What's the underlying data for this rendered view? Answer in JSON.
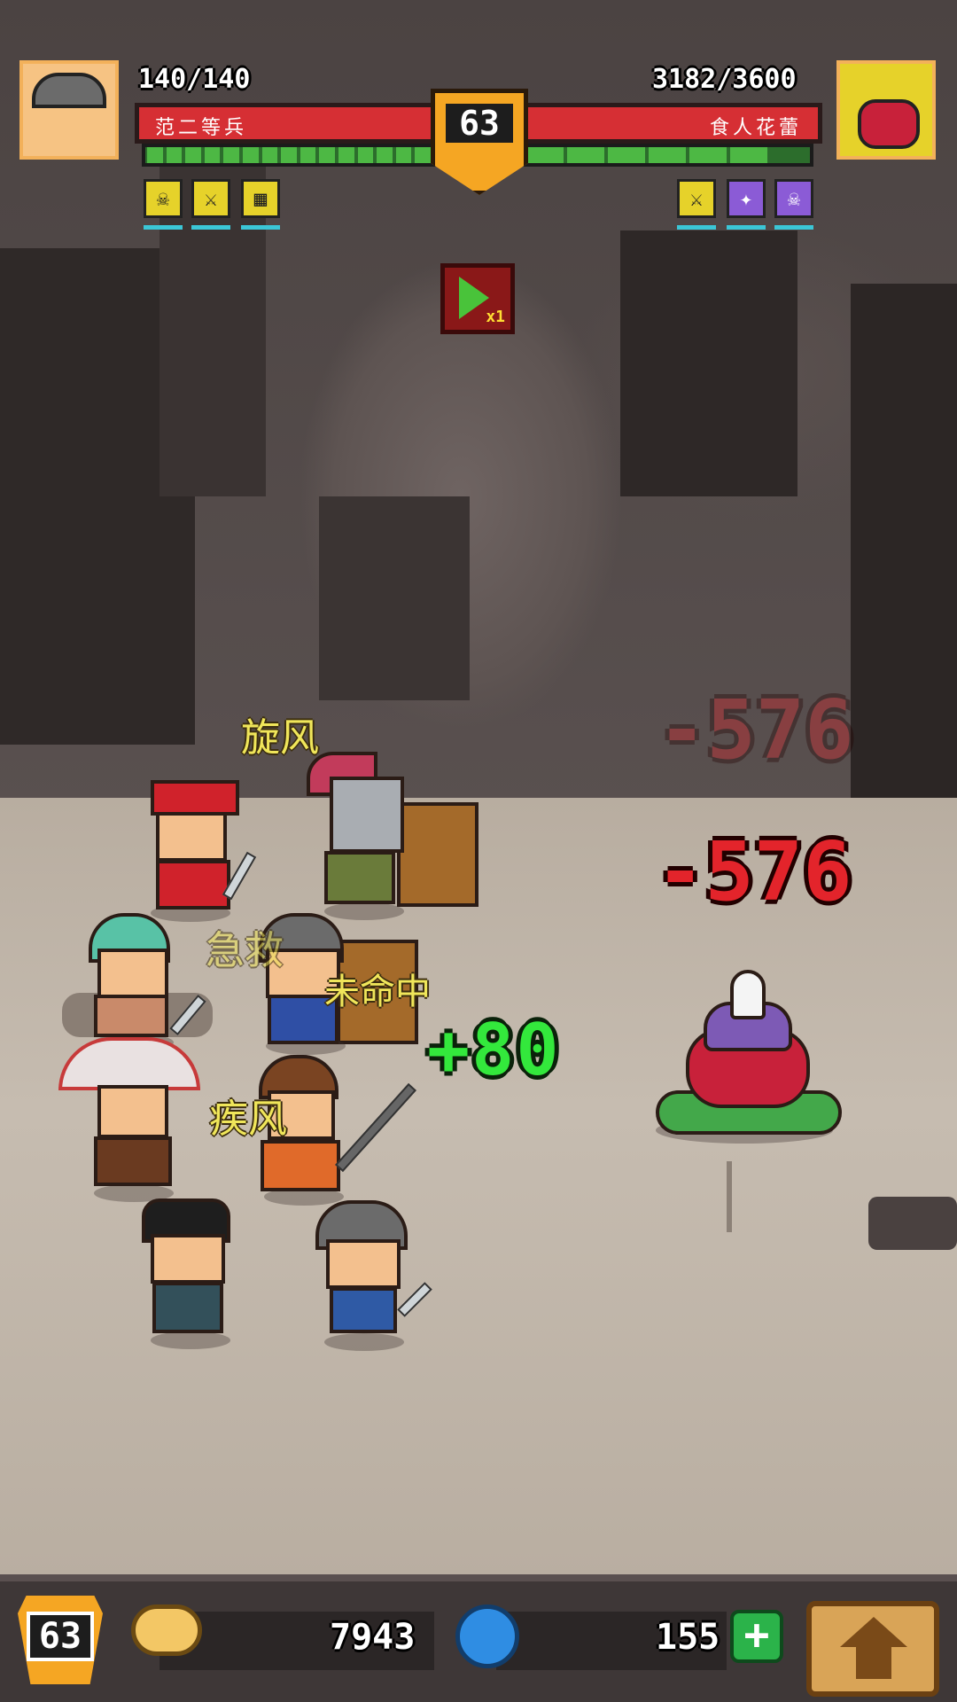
{
  "hud": {
    "player": {
      "hp": "140/140",
      "name": "范二等兵"
    },
    "enemy": {
      "hp": "3182/3600",
      "name": "食人花蕾"
    },
    "stage_level": "63",
    "speed_label": "x1"
  },
  "battle": {
    "floaters": [
      "旋风",
      "急救",
      "未命中",
      "疾风"
    ],
    "heal": "+80",
    "damage": "-576",
    "damage_ghost": "-576"
  },
  "bottom": {
    "player_level": "63",
    "gold": "7943",
    "gems": "155",
    "add_label": "+"
  },
  "colors": {
    "hp_red": "#d62f34",
    "energy_green": "#4db844",
    "badge_orange": "#f5a623",
    "heal_green": "#33e83c",
    "damage_red": "#e3242b",
    "skill_yellow": "#f0e65a"
  },
  "icons": {
    "player_buffs": [
      "skull-icon",
      "sword-icon",
      "shield-icon"
    ],
    "enemy_buffs": [
      "sword-icon",
      "magic-icon",
      "skull-icon"
    ]
  }
}
